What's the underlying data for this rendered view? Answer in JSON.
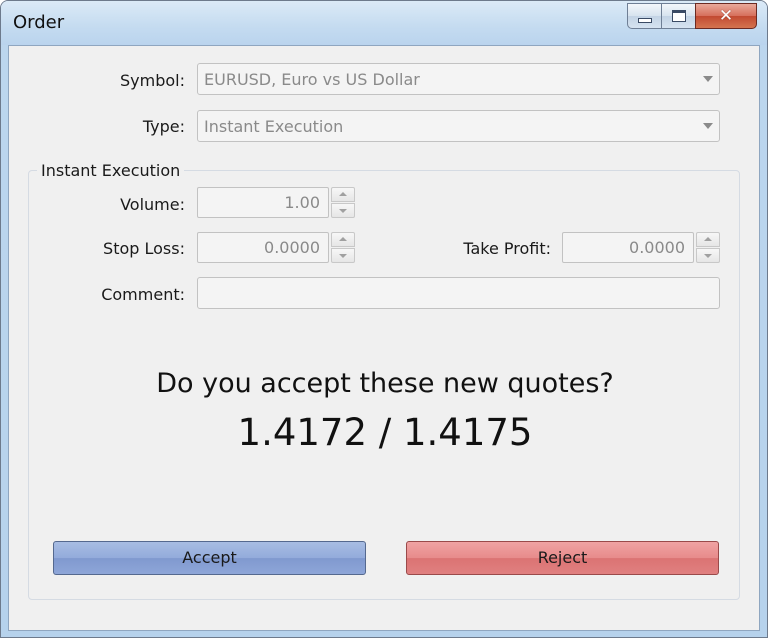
{
  "window": {
    "title": "Order",
    "caption_minimize": "minimize",
    "caption_maximize": "maximize",
    "caption_close": "✕"
  },
  "form": {
    "symbol": {
      "label": "Symbol:",
      "value": "EURUSD, Euro vs US Dollar"
    },
    "type": {
      "label": "Type:",
      "value": "Instant Execution"
    },
    "group_title": "Instant Execution",
    "volume": {
      "label": "Volume:",
      "value": "1.00"
    },
    "stop_loss": {
      "label": "Stop Loss:",
      "value": "0.0000"
    },
    "take_profit": {
      "label": "Take Profit:",
      "value": "0.0000"
    },
    "comment": {
      "label": "Comment:",
      "value": ""
    }
  },
  "message": {
    "question": "Do you accept these new quotes?",
    "quotes": "1.4172 / 1.4175"
  },
  "buttons": {
    "accept": "Accept",
    "reject": "Reject"
  },
  "colors": {
    "accept": "#8ea6d8",
    "reject": "#e08080",
    "disabled_text": "#8a8a8a"
  }
}
